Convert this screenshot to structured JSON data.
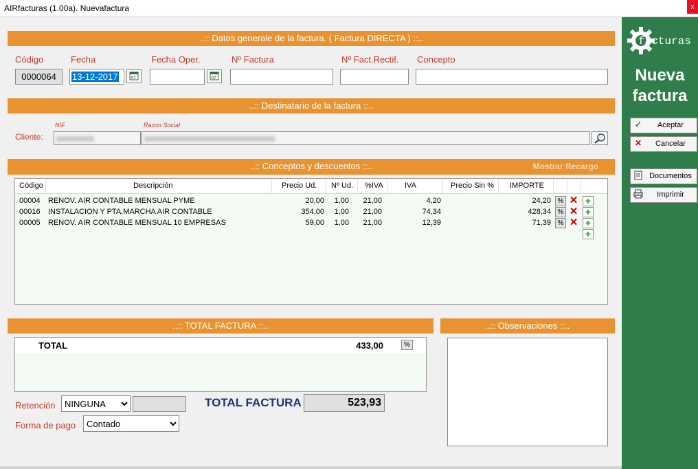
{
  "window": {
    "title": "AIRfacturas (1.00a). Nuevafactura",
    "close_glyph": "x"
  },
  "general": {
    "header": "..:: Datos generale de la factura. ( Factura DIRECTA ) ::..",
    "codigo_label": "Código",
    "codigo_value": "0000064",
    "fecha_label": "Fecha",
    "fecha_value": "13-12-2017",
    "fecha_oper_label": "Fecha Oper.",
    "fecha_oper_value": "",
    "num_factura_label": "Nº Factura",
    "num_factura_value": "",
    "num_rectif_label": "Nº Fact.Rectif.",
    "num_rectif_value": "",
    "concepto_label": "Concepto",
    "concepto_value": ""
  },
  "destinatario": {
    "header": "..:: Destinatario de la factura ::..",
    "nif_label": "NIF",
    "razon_label": "Razon Social",
    "cliente_label": "Cliente:"
  },
  "conceptos": {
    "header": "..:: Conceptos y descuentos ::..",
    "recargo_link": "Mostrar Recargo",
    "columns": [
      "Código",
      "Descripción",
      "Precio Ud.",
      "Nº Ud.",
      "%IVA",
      "IVA",
      "Precio Sin %",
      "IMPORTE"
    ],
    "rows": [
      {
        "codigo": "00004",
        "descripcion": "RENOV. AIR CONTABLE MENSUAL PYME",
        "precio": "20,00",
        "unidades": "1,00",
        "piva": "21,00",
        "iva": "4,20",
        "importe": "24,20"
      },
      {
        "codigo": "00016",
        "descripcion": "INSTALACION Y PTA.MARCHA AIR CONTABLE",
        "precio": "354,00",
        "unidades": "1,00",
        "piva": "21,00",
        "iva": "74,34",
        "importe": "428,34"
      },
      {
        "codigo": "00005",
        "descripcion": "RENOV. AIR CONTABLE MENSUAL 10 EMPRESAS",
        "precio": "59,00",
        "unidades": "1,00",
        "piva": "21,00",
        "iva": "12,39",
        "importe": "71,39"
      }
    ],
    "pct_glyph": "%",
    "delete_glyph": "✕",
    "add_glyph": "+"
  },
  "total": {
    "header": "..:: TOTAL FACTURA ::..",
    "total_label": "TOTAL",
    "total_value": "433,00",
    "pct_glyph": "%",
    "retencion_label": "Retención",
    "retencion_value": "NINGUNA",
    "total_factura_label": "TOTAL FACTURA",
    "total_factura_value": "523,93",
    "forma_pago_label": "Forma de pago",
    "forma_pago_value": "Contado"
  },
  "observaciones": {
    "header": "..:: Observaciones ::.."
  },
  "sidebar": {
    "logo_text": "facturas",
    "title_line1": "Nueva",
    "title_line2": "factura",
    "aceptar": "Aceptar",
    "cancelar": "Cancelar",
    "documentos": "Documentos",
    "imprimir": "Imprimir"
  },
  "colors": {
    "band": "#e8932f",
    "sidebar": "#2e7d4a",
    "label": "#c0392b",
    "total_factura": "#1f2f7a"
  }
}
